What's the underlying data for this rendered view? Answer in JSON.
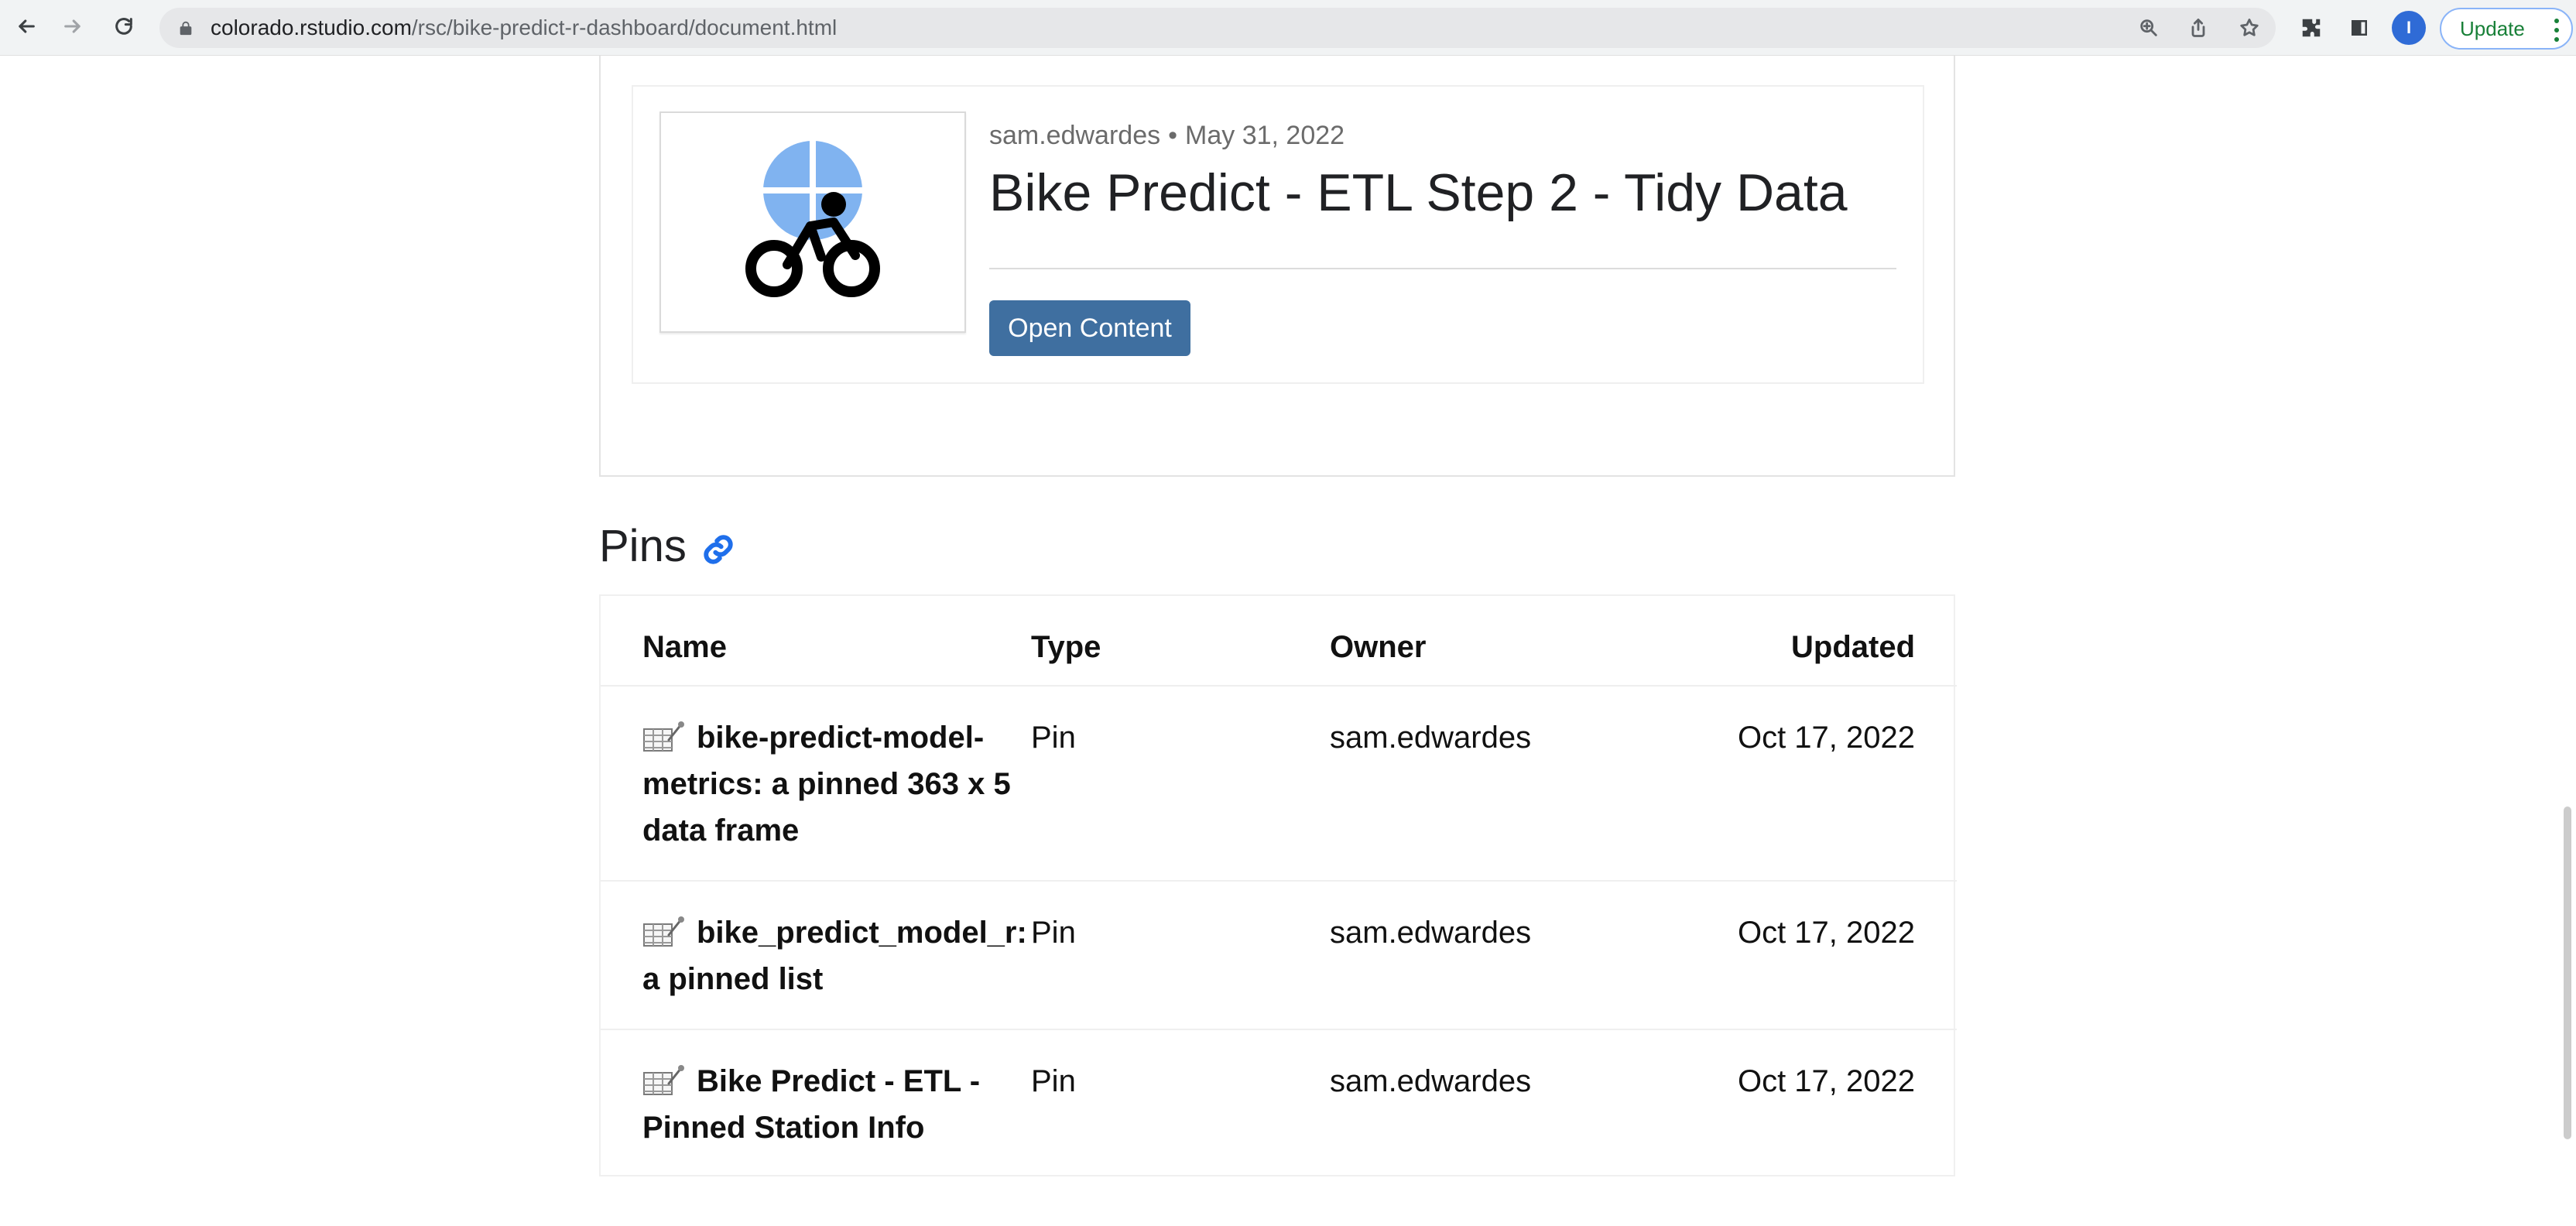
{
  "browser": {
    "url_host": "colorado.rstudio.com",
    "url_path": "/rsc/bike-predict-r-dashboard/document.html",
    "profile_initial": "I",
    "update_label": "Update"
  },
  "content_card": {
    "author": "sam.edwardes",
    "date": "May 31, 2022",
    "separator": "•",
    "title": "Bike Predict - ETL Step 2 - Tidy Data",
    "open_button_label": "Open Content"
  },
  "pins_section": {
    "title": "Pins",
    "columns": {
      "name": "Name",
      "type": "Type",
      "owner": "Owner",
      "updated": "Updated"
    },
    "rows": [
      {
        "name": "bike-predict-model-metrics: a pinned 363 x 5 data frame",
        "type": "Pin",
        "owner": "sam.edwardes",
        "updated": "Oct 17, 2022"
      },
      {
        "name": "bike_predict_model_r: a pinned list",
        "type": "Pin",
        "owner": "sam.edwardes",
        "updated": "Oct 17, 2022"
      },
      {
        "name": "Bike Predict - ETL - Pinned Station Info",
        "type": "Pin",
        "owner": "sam.edwardes",
        "updated": "Oct 17, 2022"
      }
    ]
  },
  "icons": {
    "toolbar": [
      "back-icon",
      "forward-icon",
      "reload-icon",
      "lock-icon",
      "zoom-icon",
      "share-icon",
      "star-icon",
      "extensions-icon",
      "sidebar-icon",
      "more-icon"
    ],
    "content": [
      "bike-logo-icon",
      "link-icon",
      "pin-table-icon"
    ]
  },
  "colors": {
    "button_blue": "#3f6fa0",
    "link_blue": "#1f6feb",
    "update_green": "#188038",
    "logo_blue": "#80b3f0"
  }
}
